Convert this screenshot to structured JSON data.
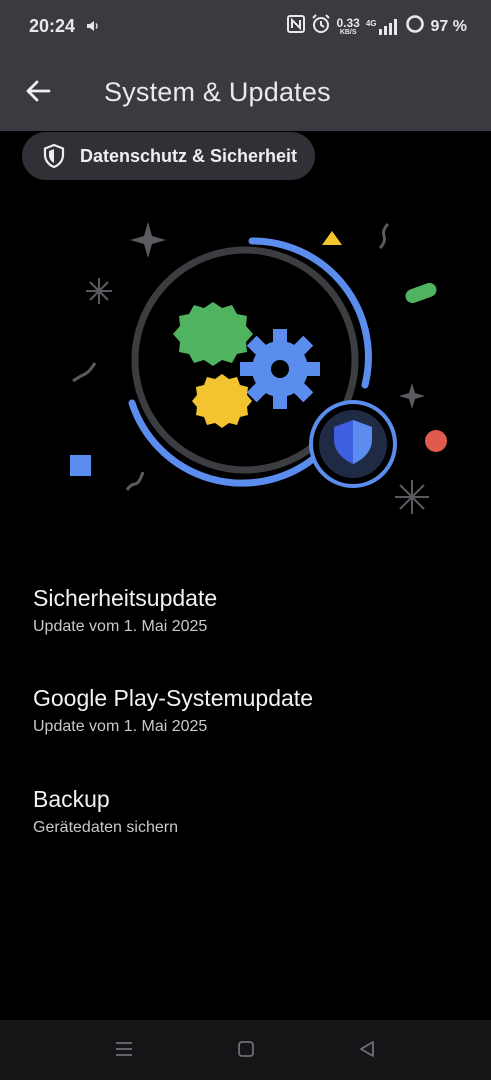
{
  "status_bar": {
    "time": "20:24",
    "net_speed_value": "0.33",
    "net_speed_unit": "KB/S",
    "network_type": "4G",
    "battery": "97 %"
  },
  "app_bar": {
    "title": "System & Updates",
    "back_icon": "arrow-left-icon"
  },
  "chip": {
    "label": "Datenschutz & Sicherheit",
    "icon": "shield-icon"
  },
  "items": [
    {
      "title": "Sicherheitsupdate",
      "subtitle": "Update vom 1. Mai 2025"
    },
    {
      "title": "Google Play-Systemupdate",
      "subtitle": "Update vom 1. Mai 2025"
    },
    {
      "title": "Backup",
      "subtitle": "Gerätedaten sichern"
    }
  ],
  "nav_bar": {
    "buttons": [
      "menu-icon",
      "home-square-icon",
      "back-triangle-icon"
    ]
  },
  "colors": {
    "background": "#000000",
    "bars": "#3a3b40",
    "accent_blue": "#5b8def",
    "green": "#4fb35f",
    "yellow": "#f4c430",
    "red": "#e05a4f"
  }
}
